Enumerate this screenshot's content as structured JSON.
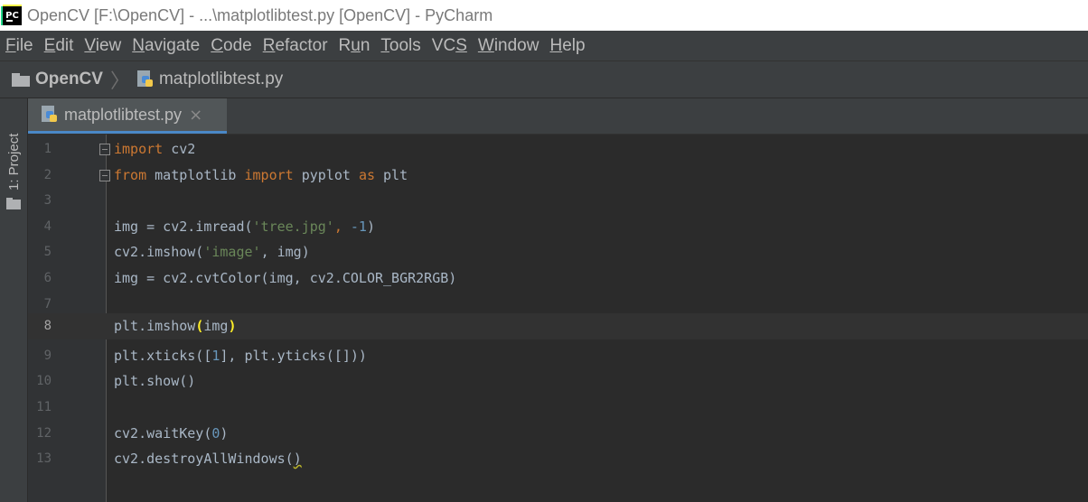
{
  "window": {
    "title": "OpenCV [F:\\OpenCV] - ...\\matplotlibtest.py [OpenCV] - PyCharm",
    "app_icon": "pycharm-logo",
    "app_icon_text": "PC"
  },
  "menu": [
    {
      "label": "File",
      "mnemonic": "F",
      "rest": "ile"
    },
    {
      "label": "Edit",
      "mnemonic": "E",
      "rest": "dit"
    },
    {
      "label": "View",
      "mnemonic": "V",
      "rest": "iew"
    },
    {
      "label": "Navigate",
      "mnemonic": "N",
      "rest": "avigate"
    },
    {
      "label": "Code",
      "mnemonic": "C",
      "rest": "ode"
    },
    {
      "label": "Refactor",
      "mnemonic": "R",
      "rest": "efactor"
    },
    {
      "label": "Run",
      "mnemonic": "",
      "rest": "Run"
    },
    {
      "label": "Tools",
      "mnemonic": "T",
      "rest": "ools"
    },
    {
      "label": "VCS",
      "mnemonic": "",
      "rest": "VCS"
    },
    {
      "label": "Window",
      "mnemonic": "W",
      "rest": "indow"
    },
    {
      "label": "Help",
      "mnemonic": "H",
      "rest": "elp"
    }
  ],
  "breadcrumb": {
    "project": "OpenCV",
    "separator": "〉",
    "file": "matplotlibtest.py"
  },
  "tool_window": {
    "project_label": "1: Project"
  },
  "tab": {
    "label": "matplotlibtest.py",
    "close_glyph": "×"
  },
  "editor": {
    "current_line": 8,
    "lines": [
      {
        "n": "1",
        "fold": true
      },
      {
        "n": "2",
        "fold": true
      },
      {
        "n": "3"
      },
      {
        "n": "4"
      },
      {
        "n": "5"
      },
      {
        "n": "6"
      },
      {
        "n": "7"
      },
      {
        "n": "8"
      },
      {
        "n": "9"
      },
      {
        "n": "10"
      },
      {
        "n": "11"
      },
      {
        "n": "12"
      },
      {
        "n": "13"
      }
    ],
    "tokens": {
      "l1_kw": "import",
      "l1_rest": " cv2",
      "l2_kw1": "from",
      "l2_mod": " matplotlib ",
      "l2_kw2": "import",
      "l2_mid": " pyplot ",
      "l2_kw3": "as",
      "l2_alias": " plt",
      "l4_a": "img = cv2.imread(",
      "l4_str": "'tree.jpg'",
      "l4_comma": ", ",
      "l4_num": "-1",
      "l4_close": ")",
      "l5_a": "cv2.imshow(",
      "l5_str": "'image'",
      "l5_rest": ", img)",
      "l6": "img = cv2.cvtColor(img, cv2.COLOR_BGR2RGB)",
      "l8_a": "plt.imshow",
      "l8_open": "(",
      "l8_arg": "img",
      "l8_close": ")",
      "l9_a": "plt.xticks([",
      "l9_num": "1",
      "l9_rest": "], plt.yticks([]))",
      "l10": "plt.show()",
      "l12_a": "cv2.waitKey(",
      "l12_num": "0",
      "l12_close": ")",
      "l13_a": "cv2.destroyAllWindows(",
      "l13_close": ")"
    }
  },
  "colors": {
    "keyword": "#cc7832",
    "string": "#6a8759",
    "number": "#6897bb",
    "text": "#a9b7c6",
    "brace_match": "#ffef28",
    "editor_bg": "#2b2b2b",
    "chrome_bg": "#3c3f41"
  }
}
